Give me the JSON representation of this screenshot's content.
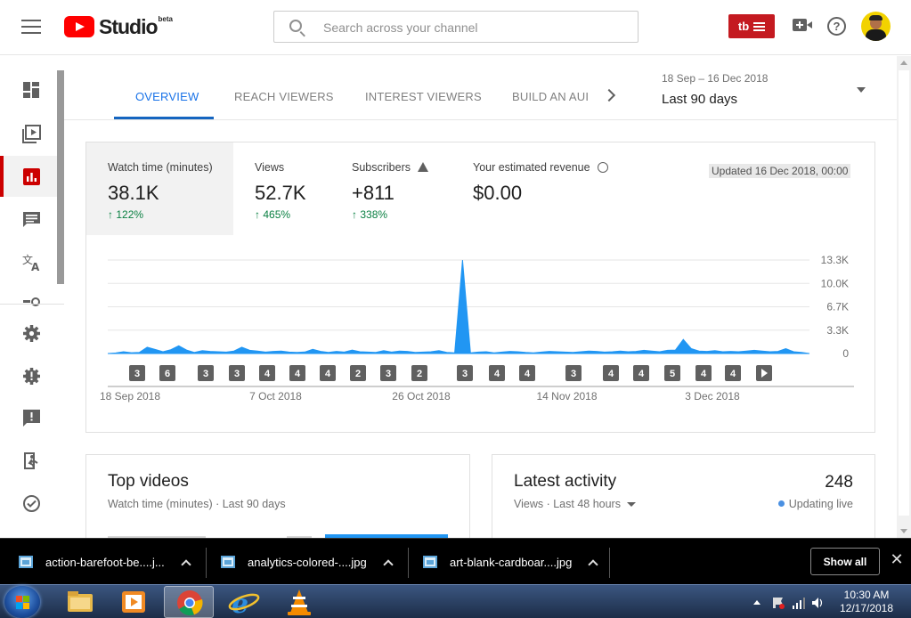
{
  "header": {
    "logo_text": "Studio",
    "beta_label": "beta",
    "search_placeholder": "Search across your channel",
    "tubebuddy_label": "tb"
  },
  "tabs": [
    {
      "label": "OVERVIEW",
      "active": true
    },
    {
      "label": "REACH VIEWERS",
      "active": false
    },
    {
      "label": "INTEREST VIEWERS",
      "active": false
    },
    {
      "label": "BUILD AN AUI",
      "active": false
    }
  ],
  "date_range": {
    "range": "18 Sep – 16 Dec 2018",
    "period": "Last 90 days"
  },
  "metrics": [
    {
      "label": "Watch time (minutes)",
      "value": "38.1K",
      "delta": "122%",
      "active": true
    },
    {
      "label": "Views",
      "value": "52.7K",
      "delta": "465%",
      "active": false
    },
    {
      "label": "Subscribers",
      "value": "+811",
      "delta": "338%",
      "active": false
    },
    {
      "label": "Your estimated revenue",
      "value": "$0.00",
      "delta": "",
      "active": false
    }
  ],
  "updated": "Updated 16 Dec 2018, 00:00",
  "chart_data": {
    "type": "area",
    "series": [
      {
        "values": [
          0,
          80,
          250,
          120,
          150,
          900,
          600,
          250,
          550,
          1100,
          500,
          150,
          400,
          300,
          250,
          200,
          350,
          900,
          450,
          350,
          200,
          300,
          350,
          200,
          150,
          220,
          600,
          300,
          150,
          300,
          200,
          500,
          250,
          200,
          150,
          400,
          200,
          350,
          300,
          150,
          200,
          250,
          400,
          150,
          100,
          13300,
          100,
          200,
          250,
          100,
          200,
          300,
          250,
          150,
          100,
          200,
          300,
          250,
          200,
          150,
          250,
          350,
          300,
          200,
          250,
          350,
          250,
          300,
          450,
          350,
          250,
          450,
          500,
          2000,
          700,
          350,
          300,
          400,
          250,
          300,
          250,
          350,
          450,
          350,
          250,
          300,
          700,
          250,
          150,
          0
        ]
      }
    ],
    "x_ticks": [
      "18 Sep 2018",
      "7 Oct 2018",
      "26 Oct 2018",
      "14 Nov 2018",
      "3 Dec 2018"
    ],
    "y_ticks": [
      "13.3K",
      "10.0K",
      "6.7K",
      "3.3K",
      "0"
    ],
    "ylim": [
      0,
      13300
    ],
    "color": "#2196f3",
    "badges": [
      "3",
      "6",
      "3",
      "3",
      "4",
      "4",
      "4",
      "2",
      "3",
      "2",
      "3",
      "4",
      "4",
      "3",
      "4",
      "4",
      "5",
      "4",
      "4"
    ]
  },
  "top_videos": {
    "title": "Top videos",
    "subtitle": "Watch time (minutes) · Last 90 days"
  },
  "latest_activity": {
    "title": "Latest activity",
    "subtitle": "Views · Last 48 hours",
    "count": "248",
    "live_label": "Updating live"
  },
  "downloads": {
    "items": [
      "action-barefoot-be....j...",
      "analytics-colored-....jpg",
      "art-blank-cardboar....jpg"
    ],
    "show_all": "Show all",
    "close": "✕"
  },
  "taskbar": {
    "time": "10:30 AM",
    "date": "12/17/2018"
  }
}
